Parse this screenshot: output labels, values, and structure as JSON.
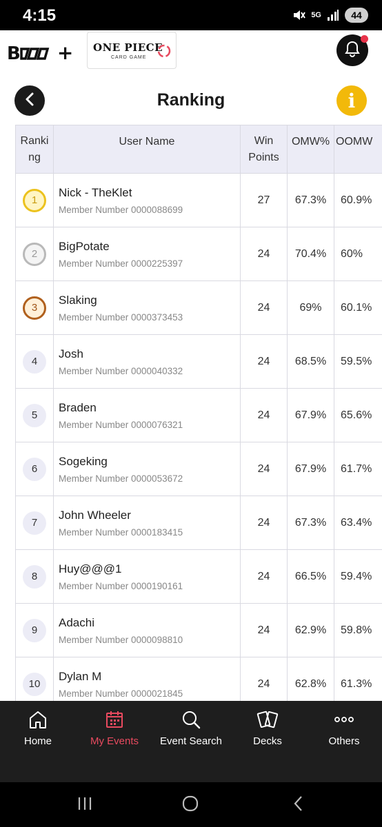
{
  "status_bar": {
    "time": "4:15",
    "network": "5G",
    "battery": "44"
  },
  "header": {
    "brand": "B",
    "brand_plus": "+",
    "partner_logo_title": "ONE PIECE",
    "partner_logo_sub": "CARD GAME"
  },
  "page": {
    "title": "Ranking",
    "info_glyph": "i"
  },
  "table": {
    "headers": {
      "rank_line1": "Ranki",
      "rank_line2": "ng",
      "user": "User Name",
      "wp_line1": "Win",
      "wp_line2": "Points",
      "omw": "OMW%",
      "oomw": "OOMW"
    },
    "rows": [
      {
        "rank": "1",
        "name": "Nick - TheKlet",
        "member": "Member Number 0000088699",
        "wp": "27",
        "omw": "67.3%",
        "oomw": "60.9%"
      },
      {
        "rank": "2",
        "name": "BigPotate",
        "member": "Member Number 0000225397",
        "wp": "24",
        "omw": "70.4%",
        "oomw": "60%"
      },
      {
        "rank": "3",
        "name": "Slaking",
        "member": "Member Number 0000373453",
        "wp": "24",
        "omw": "69%",
        "oomw": "60.1%"
      },
      {
        "rank": "4",
        "name": "Josh",
        "member": "Member Number 0000040332",
        "wp": "24",
        "omw": "68.5%",
        "oomw": "59.5%"
      },
      {
        "rank": "5",
        "name": "Braden",
        "member": "Member Number 0000076321",
        "wp": "24",
        "omw": "67.9%",
        "oomw": "65.6%"
      },
      {
        "rank": "6",
        "name": "Sogeking",
        "member": "Member Number 0000053672",
        "wp": "24",
        "omw": "67.9%",
        "oomw": "61.7%"
      },
      {
        "rank": "7",
        "name": "John Wheeler",
        "member": "Member Number 0000183415",
        "wp": "24",
        "omw": "67.3%",
        "oomw": "63.4%"
      },
      {
        "rank": "8",
        "name": "Huy@@@1",
        "member": "Member Number 0000190161",
        "wp": "24",
        "omw": "66.5%",
        "oomw": "59.4%"
      },
      {
        "rank": "9",
        "name": "Adachi",
        "member": "Member Number 0000098810",
        "wp": "24",
        "omw": "62.9%",
        "oomw": "59.8%"
      },
      {
        "rank": "10",
        "name": "Dylan M",
        "member": "Member Number 0000021845",
        "wp": "24",
        "omw": "62.8%",
        "oomw": "61.3%"
      }
    ]
  },
  "nav": {
    "items": [
      {
        "label": "Home",
        "icon": "home-icon"
      },
      {
        "label": "My Events",
        "icon": "calendar-icon",
        "active": true
      },
      {
        "label": "Event Search",
        "icon": "search-icon"
      },
      {
        "label": "Decks",
        "icon": "cards-icon"
      },
      {
        "label": "Others",
        "icon": "more-icon"
      }
    ]
  },
  "colors": {
    "accent_active": "#e84a5f",
    "info_yellow": "#f2b90a",
    "gold": "#ecc21d",
    "silver": "#b9b9b9",
    "bronze": "#b0601d"
  }
}
